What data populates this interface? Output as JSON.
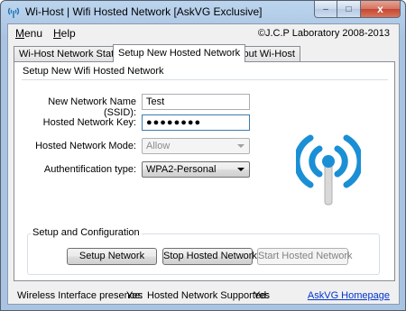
{
  "window": {
    "title": "Wi-Host | Wifi Hosted Network [AskVG Exclusive]",
    "caption_minimize": "–",
    "caption_maximize": "□",
    "caption_close": "x"
  },
  "menubar": {
    "items": [
      {
        "label": "Menu",
        "mnemonic": "M",
        "rest": "enu"
      },
      {
        "label": "Help",
        "mnemonic": "H",
        "rest": "elp"
      }
    ],
    "copyright": "©J.C.P Laboratory 2008-2013"
  },
  "tabs": [
    {
      "label": "Wi-Host Network Status",
      "active": false
    },
    {
      "label": "Setup New Hosted Network",
      "active": true
    },
    {
      "label": "About Wi-Host",
      "active": false
    }
  ],
  "setup": {
    "group_title": "Setup New Wifi Hosted Network",
    "ssid_label": "New Network Name (SSID):",
    "ssid_value": "Test",
    "key_label": "Hosted Network Key:",
    "key_value": "●●●●●●●●",
    "mode_label": "Hosted Network Mode:",
    "mode_value": "Allow",
    "auth_label": "Authentification type:",
    "auth_value": "WPA2-Personal"
  },
  "config": {
    "title": "Setup and Configuration",
    "setup_button": "Setup Network",
    "stop_button": "Stop Hosted Network",
    "start_button": "Start Hosted Network"
  },
  "status": {
    "presence_label": "Wireless Interface presence:",
    "presence_value": "Yes",
    "supported_label": "Hosted Network Supported:",
    "supported_value": "Yes",
    "homepage_link": "AskVG Homepage"
  },
  "colors": {
    "icon_blue": "#1a8fd6",
    "link": "#0033cc"
  },
  "icons": {
    "app": "wifi-antenna-icon",
    "hero": "wifi-hotspot-icon"
  }
}
